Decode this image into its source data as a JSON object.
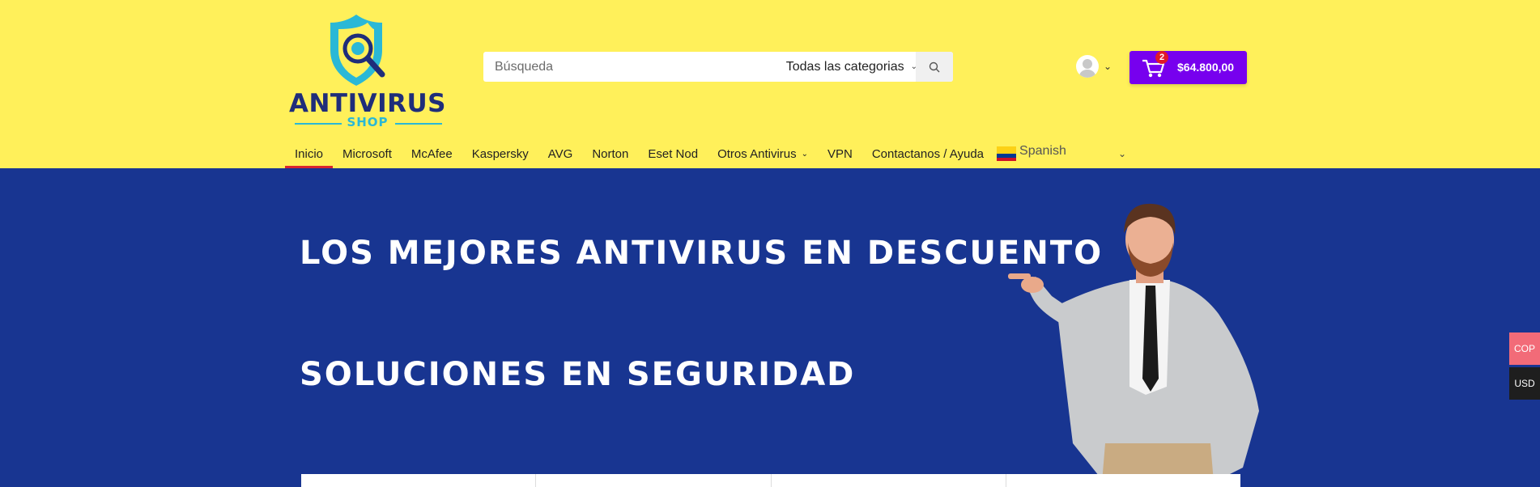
{
  "logo": {
    "title": "ANTIVIRUS",
    "subtitle": "SHOP"
  },
  "search": {
    "placeholder": "Búsqueda",
    "category": "Todas las categorias"
  },
  "cart": {
    "count": "2",
    "total": "$64.800,00"
  },
  "nav": {
    "items": [
      {
        "label": "Inicio"
      },
      {
        "label": "Microsoft"
      },
      {
        "label": "McAfee"
      },
      {
        "label": "Kaspersky"
      },
      {
        "label": "AVG"
      },
      {
        "label": "Norton"
      },
      {
        "label": "Eset Nod"
      },
      {
        "label": "Otros Antivirus"
      },
      {
        "label": "VPN"
      },
      {
        "label": "Contactanos / Ayuda"
      }
    ],
    "language": "Spanish"
  },
  "hero": {
    "title1": "LOS MEJORES ANTIVIRUS EN DESCUENTO",
    "title2": "SOLUCIONES EN SEGURIDAD"
  },
  "currency": {
    "cop": "COP",
    "usd": "USD"
  },
  "colors": {
    "header_bg": "#fff05a",
    "hero_bg": "#183591",
    "cart_bg": "#7700ee",
    "active_underline": "#d9262f"
  }
}
